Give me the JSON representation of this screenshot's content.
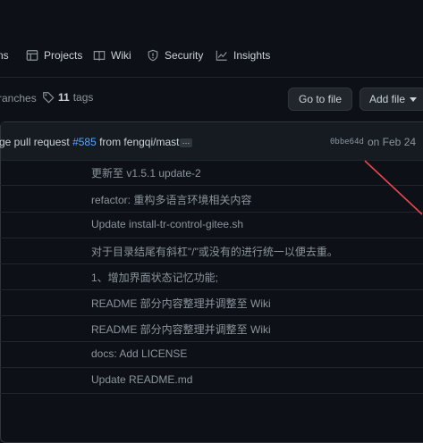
{
  "nav": {
    "items": [
      {
        "label": "ns",
        "icon": "code-icon"
      },
      {
        "label": "Projects",
        "icon": "table-icon"
      },
      {
        "label": "Wiki",
        "icon": "book-icon"
      },
      {
        "label": "Security",
        "icon": "shield-icon"
      },
      {
        "label": "Insights",
        "icon": "graph-icon"
      }
    ]
  },
  "repo": {
    "branches_label": "ranches",
    "tags_count": "11",
    "tags_label": "tags",
    "goto_file": "Go to file",
    "add_file": "Add file"
  },
  "latest_commit": {
    "prefix": "ge pull request ",
    "pr_link": "#585",
    "suffix": " from fengqi/master",
    "ellipsis": "…",
    "sha": "0bbe64d",
    "date": "on Feb 24"
  },
  "files": [
    {
      "message": "更新至 v1.5.1 update-2"
    },
    {
      "message": "refactor: 重构多语言环境相关内容"
    },
    {
      "message": "Update install-tr-control-gitee.sh"
    },
    {
      "message": "对于目录结尾有斜杠\"/\"或没有的进行统一以便去重。"
    },
    {
      "message": "1、增加界面状态记忆功能;"
    },
    {
      "message": "README 部分内容整理并调整至 Wiki"
    },
    {
      "message": "README 部分内容整理并调整至 Wiki"
    },
    {
      "message": "docs: Add LICENSE"
    },
    {
      "message": "Update README.md"
    }
  ],
  "colors": {
    "background": "#0d1117",
    "link": "#58a6ff",
    "annotation": "#e5484d"
  }
}
